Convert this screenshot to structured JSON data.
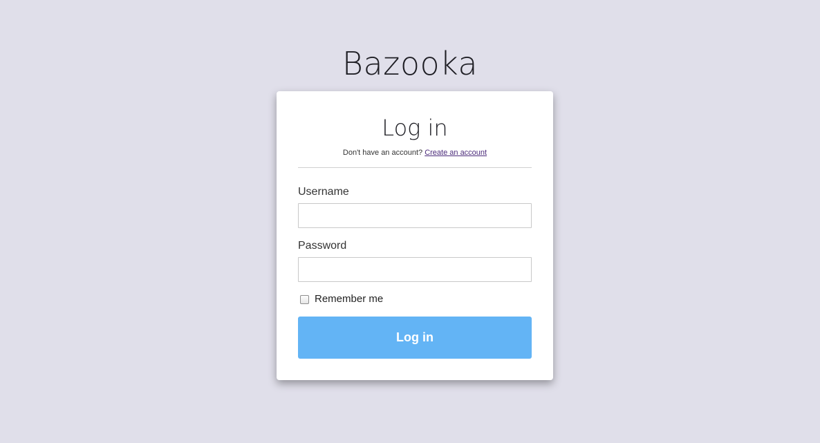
{
  "app": {
    "title": "Bazooka"
  },
  "login_form": {
    "title": "Log in",
    "signup_prompt": "Don't have an account?",
    "signup_link": "Create an account",
    "username_label": "Username",
    "username_value": "",
    "password_label": "Password",
    "password_value": "",
    "remember_label": "Remember me",
    "remember_checked": false,
    "submit_label": "Log in"
  },
  "colors": {
    "background": "#e0dfea",
    "card": "#ffffff",
    "button": "#63b4f5",
    "link": "#4b2b7a"
  }
}
